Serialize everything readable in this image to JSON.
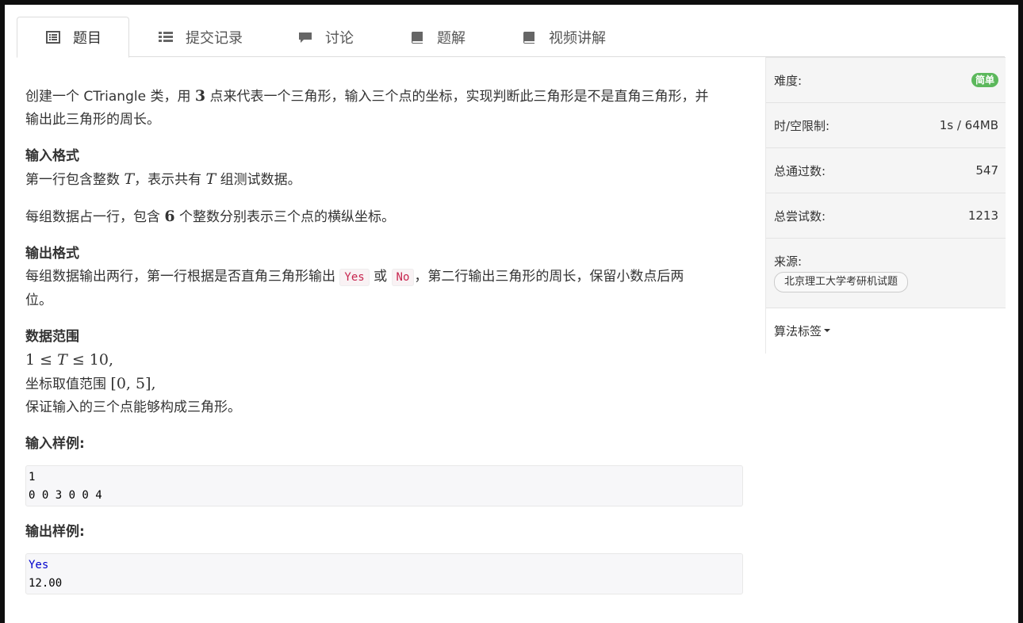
{
  "tabs": [
    {
      "label": "题目",
      "icon": "document-list-icon"
    },
    {
      "label": "提交记录",
      "icon": "list-icon"
    },
    {
      "label": "讨论",
      "icon": "comment-icon"
    },
    {
      "label": "题解",
      "icon": "book-icon"
    },
    {
      "label": "视频讲解",
      "icon": "book-icon"
    }
  ],
  "problem": {
    "desc_a": "创建一个 CTriangle 类，用 ",
    "desc_num": "3",
    "desc_b": " 点来代表一个三角形，输入三个点的坐标，实现判断此三角形是不是直角三角形，并",
    "desc_c": "输出此三角形的周长。",
    "input_heading": "输入格式",
    "input_l1_a": "第一行包含整数 ",
    "input_l1_var": "T",
    "input_l1_b": "，表示共有 ",
    "input_l1_var2": "T",
    "input_l1_c": " 组测试数据。",
    "input_l2_a": "每组数据占一行，包含 ",
    "input_l2_num": "6",
    "input_l2_b": " 个整数分别表示三个点的横纵坐标。",
    "output_heading": "输出格式",
    "output_a": "每组数据输出两行，第一行根据是否直角三角形输出 ",
    "output_code1": "Yes",
    "output_or": " 或 ",
    "output_code2": "No",
    "output_b": "，第二行输出三角形的周长，保留小数点后两",
    "output_c": "位。",
    "range_heading": "数据范围",
    "range_l1_a": "1",
    "range_l1_le1": " ≤ ",
    "range_l1_var": "T",
    "range_l1_le2": " ≤ ",
    "range_l1_b": "10",
    "range_l1_c": ",",
    "range_l2_a": "坐标取值范围 ",
    "range_l2_math": "[0, 5]",
    "range_l2_b": ",",
    "range_l3": "保证输入的三个点能够构成三角形。",
    "sample_in_heading": "输入样例:",
    "sample_in_l1": "1",
    "sample_in_l2": "0 0 3 0 0 4",
    "sample_out_heading": "输出样例:",
    "sample_out_l1": "Yes",
    "sample_out_l2": "12.00"
  },
  "sidebar": {
    "difficulty_label": "难度:",
    "difficulty_value": "简单",
    "limit_label": "时/空限制:",
    "limit_value": "1s / 64MB",
    "passed_label": "总通过数:",
    "passed_value": "547",
    "tried_label": "总尝试数:",
    "tried_value": "1213",
    "source_label": "来源:",
    "source_tag": "北京理工大学考研机试题",
    "tags_label": "算法标签"
  },
  "colors": {
    "badge": "#5cb85c",
    "code_inline": "#c7254e",
    "keyword": "#0000cc"
  }
}
